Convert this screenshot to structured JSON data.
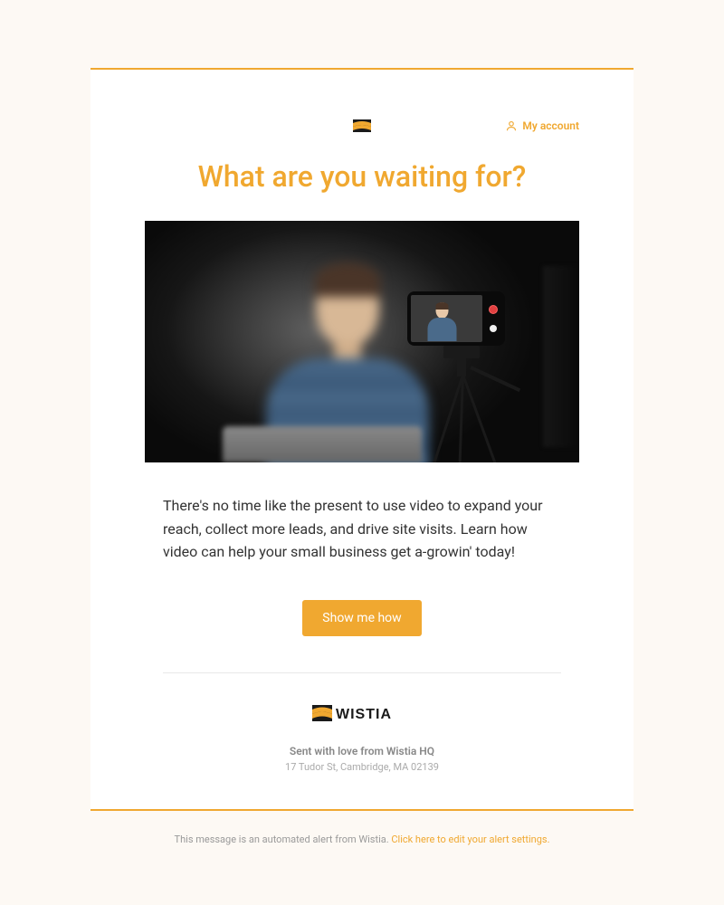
{
  "colors": {
    "accent": "#f0a830",
    "background": "#fdf9f4",
    "card": "#ffffff"
  },
  "header": {
    "account_link": "My account",
    "logo_name": "wistia-logo-small"
  },
  "heading": "What are you waiting for?",
  "hero": {
    "alt": "Person being recorded by a smartphone on a tripod"
  },
  "body_text": "There's no time like the present to use video to expand your reach, collect more leads, and drive site visits. Learn how video can help your small business get a-growin' today!",
  "cta": {
    "label": "Show me how"
  },
  "footer": {
    "brand": "WISTIA",
    "sent_from": "Sent with love from Wistia HQ",
    "address": "17 Tudor St, Cambridge, MA 02139"
  },
  "disclaimer": {
    "prefix": "This message is an automated alert from Wistia. ",
    "link": "Click here to edit your alert settings."
  }
}
